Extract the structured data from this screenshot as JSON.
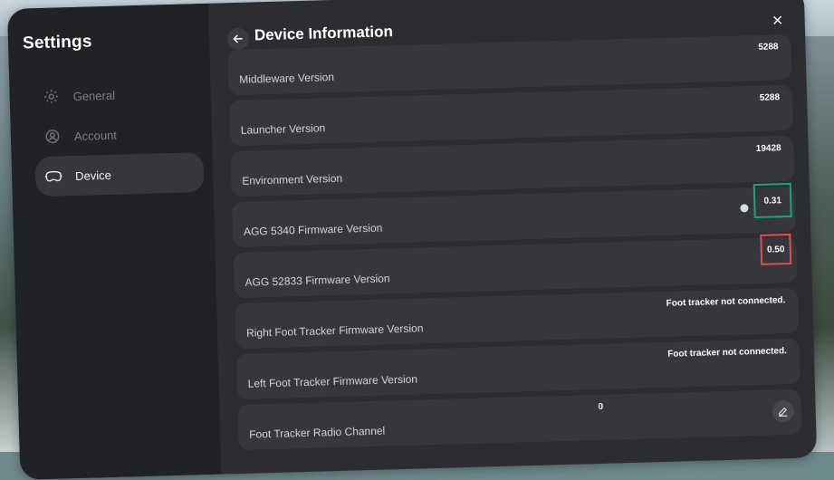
{
  "sidebar": {
    "title": "Settings",
    "items": [
      {
        "label": "General",
        "icon": "gear-icon",
        "active": false
      },
      {
        "label": "Account",
        "icon": "account-icon",
        "active": false
      },
      {
        "label": "Device",
        "icon": "headset-icon",
        "active": true
      }
    ]
  },
  "header": {
    "title": "Device Information",
    "back_icon": "back-arrow-icon",
    "close_icon": "close-icon"
  },
  "rows": [
    {
      "label": "Middleware Version",
      "value": "5288"
    },
    {
      "label": "Launcher Version",
      "value": "5288"
    },
    {
      "label": "Environment Version",
      "value": "19428"
    },
    {
      "label": "AGG 5340 Firmware Version",
      "value": "0.31"
    },
    {
      "label": "AGG 52833 Firmware Version",
      "value": "0.50"
    },
    {
      "label": "Right Foot Tracker Firmware Version",
      "value": "Foot tracker not connected."
    },
    {
      "label": "Left Foot Tracker Firmware Version",
      "value": "Foot tracker not connected."
    },
    {
      "label": "Foot Tracker Radio Channel",
      "value": "0"
    }
  ],
  "colors": {
    "highlight_teal": "#1fa37f",
    "highlight_red": "#e0504c"
  }
}
